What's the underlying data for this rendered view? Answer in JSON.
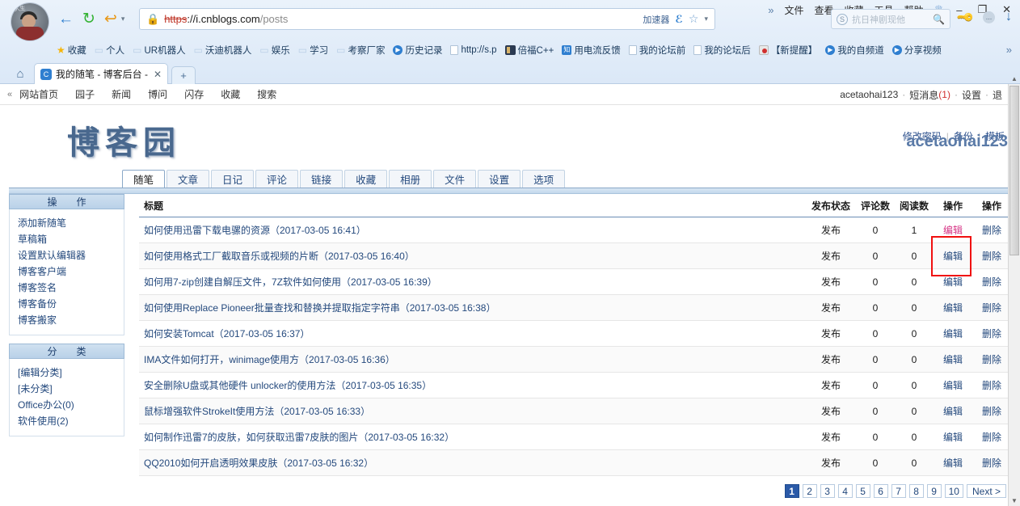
{
  "browser": {
    "menu": [
      "文件",
      "查看",
      "收藏",
      "工具",
      "帮助"
    ],
    "overflow_chevron": "»",
    "window_controls": {
      "crown": "♕",
      "minimize": "–",
      "maximize": "❐",
      "close": "✕"
    },
    "nav": {
      "back": "←",
      "reload": "↻",
      "undo": "↩",
      "caret": "▾"
    },
    "url": {
      "scheme": "https",
      "sep": "://",
      "host": "i.cnblogs.com",
      "path": "/posts",
      "lock_icon": "lock-icon"
    },
    "url_right": {
      "accelerator": "加速器",
      "engine": "ℰ",
      "star": "☆",
      "dropdown": "▾"
    },
    "search": {
      "placeholder": "抗日神剧现他",
      "logo": "S",
      "icon": "search-icon"
    },
    "right_icons": {
      "key": "key-icon",
      "more": "...",
      "download": "↓"
    },
    "bookmarks": [
      {
        "label": "收藏",
        "icon": "star"
      },
      {
        "label": "个人",
        "icon": "folder"
      },
      {
        "label": "UR机器人",
        "icon": "folder"
      },
      {
        "label": "沃迪机器人",
        "icon": "folder"
      },
      {
        "label": "娱乐",
        "icon": "folder"
      },
      {
        "label": "学习",
        "icon": "folder"
      },
      {
        "label": "考察厂家",
        "icon": "folder"
      },
      {
        "label": "历史记录",
        "icon": "circle"
      },
      {
        "label": "http://s.p",
        "icon": "page"
      },
      {
        "label": "倍福C++",
        "icon": "cpp"
      },
      {
        "label": "用电流反馈",
        "icon": "blue"
      },
      {
        "label": "我的论坛前",
        "icon": "page"
      },
      {
        "label": "我的论坛后",
        "icon": "page"
      },
      {
        "label": "【新提醒】",
        "icon": "red"
      },
      {
        "label": "我的自频道",
        "icon": "circle"
      },
      {
        "label": "分享视频",
        "icon": "circle"
      }
    ],
    "bookmarks_overflow": "»",
    "tab": {
      "title": "我的随笔 - 博客后台 -",
      "favicon": "C",
      "close": "✕"
    },
    "new_tab": "+",
    "home_icon": "home-icon"
  },
  "site_nav": {
    "collapse": "«",
    "links": [
      "网站首页",
      "园子",
      "新闻",
      "博问",
      "闪存",
      "收藏",
      "搜索"
    ],
    "account": {
      "username": "acetaohai123",
      "messages_label": "短消息",
      "messages_count": "(1)",
      "settings": "设置",
      "logout": "退"
    }
  },
  "account_links": [
    "修改密码",
    "备份",
    "模板"
  ],
  "header": {
    "logo_text": "博客园",
    "username": "acetaohai123"
  },
  "tabs": [
    {
      "label": "随笔",
      "active": true
    },
    {
      "label": "文章",
      "active": false
    },
    {
      "label": "日记",
      "active": false
    },
    {
      "label": "评论",
      "active": false
    },
    {
      "label": "链接",
      "active": false
    },
    {
      "label": "收藏",
      "active": false
    },
    {
      "label": "相册",
      "active": false
    },
    {
      "label": "文件",
      "active": false
    },
    {
      "label": "设置",
      "active": false
    },
    {
      "label": "选项",
      "active": false
    }
  ],
  "sidebar": {
    "panels": [
      {
        "title": "操　作",
        "items": [
          "添加新随笔",
          "草稿箱",
          "设置默认编辑器",
          "博客客户端",
          "博客签名",
          "博客备份",
          "博客搬家"
        ]
      },
      {
        "title": "分　类",
        "items": [
          "[编辑分类]",
          "[未分类]",
          "Office办公(0)",
          "软件使用(2)"
        ]
      }
    ]
  },
  "table": {
    "headers": [
      "标题",
      "发布状态",
      "评论数",
      "阅读数",
      "操作",
      "操作"
    ],
    "rows": [
      {
        "title": "如何使用迅雷下载电骡的资源（2017-03-05 16:41）",
        "status": "发布",
        "comments": "0",
        "reads": "1",
        "edit": "编辑",
        "delete": "删除",
        "edit_hovered": true
      },
      {
        "title": "如何使用格式工厂截取音乐或视频的片断（2017-03-05 16:40）",
        "status": "发布",
        "comments": "0",
        "reads": "0",
        "edit": "编辑",
        "delete": "删除",
        "edit_hovered": false
      },
      {
        "title": "如何用7-zip创建自解压文件，7Z软件如何使用（2017-03-05 16:39）",
        "status": "发布",
        "comments": "0",
        "reads": "0",
        "edit": "编辑",
        "delete": "删除",
        "edit_hovered": false
      },
      {
        "title": "如何使用Replace Pioneer批量查找和替换并提取指定字符串（2017-03-05 16:38）",
        "status": "发布",
        "comments": "0",
        "reads": "0",
        "edit": "编辑",
        "delete": "删除",
        "edit_hovered": false
      },
      {
        "title": "如何安装Tomcat（2017-03-05 16:37）",
        "status": "发布",
        "comments": "0",
        "reads": "0",
        "edit": "编辑",
        "delete": "删除",
        "edit_hovered": false
      },
      {
        "title": "IMA文件如何打开，winimage使用方（2017-03-05 16:36）",
        "status": "发布",
        "comments": "0",
        "reads": "0",
        "edit": "编辑",
        "delete": "删除",
        "edit_hovered": false
      },
      {
        "title": "安全删除U盘或其他硬件 unlocker的使用方法（2017-03-05 16:35）",
        "status": "发布",
        "comments": "0",
        "reads": "0",
        "edit": "编辑",
        "delete": "删除",
        "edit_hovered": false
      },
      {
        "title": "鼠标增强软件StrokeIt使用方法（2017-03-05 16:33）",
        "status": "发布",
        "comments": "0",
        "reads": "0",
        "edit": "编辑",
        "delete": "删除",
        "edit_hovered": false
      },
      {
        "title": "如何制作迅雷7的皮肤，如何获取迅雷7皮肤的图片（2017-03-05 16:32）",
        "status": "发布",
        "comments": "0",
        "reads": "0",
        "edit": "编辑",
        "delete": "删除",
        "edit_hovered": false
      },
      {
        "title": "QQ2010如何开启透明效果皮肤（2017-03-05 16:32）",
        "status": "发布",
        "comments": "0",
        "reads": "0",
        "edit": "编辑",
        "delete": "删除",
        "edit_hovered": false
      }
    ]
  },
  "pagination": {
    "pages": [
      "1",
      "2",
      "3",
      "4",
      "5",
      "6",
      "7",
      "8",
      "9",
      "10"
    ],
    "active": "1",
    "next": "Next >"
  },
  "colors": {
    "accent": "#24497d",
    "highlight_box": "#f01010",
    "hovered_link": "#d63384",
    "active_page": "#2b5aa8"
  }
}
